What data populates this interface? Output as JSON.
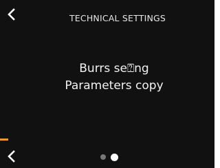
{
  "header": {
    "title": "TECHNICAL SETTINGS"
  },
  "menu": {
    "items": [
      {
        "label": "Burrs se⍰ng"
      },
      {
        "label": "Parameters copy"
      }
    ]
  },
  "pagination": {
    "current_page": 2,
    "total_pages": 2
  },
  "icons": {
    "back_top": "chevron-left-icon",
    "back_bottom": "chevron-left-icon"
  },
  "colors": {
    "background": "#111111",
    "text": "#ffffff",
    "accent": "#e89a2c",
    "dot_inactive": "#777777",
    "dot_active": "#ffffff"
  }
}
